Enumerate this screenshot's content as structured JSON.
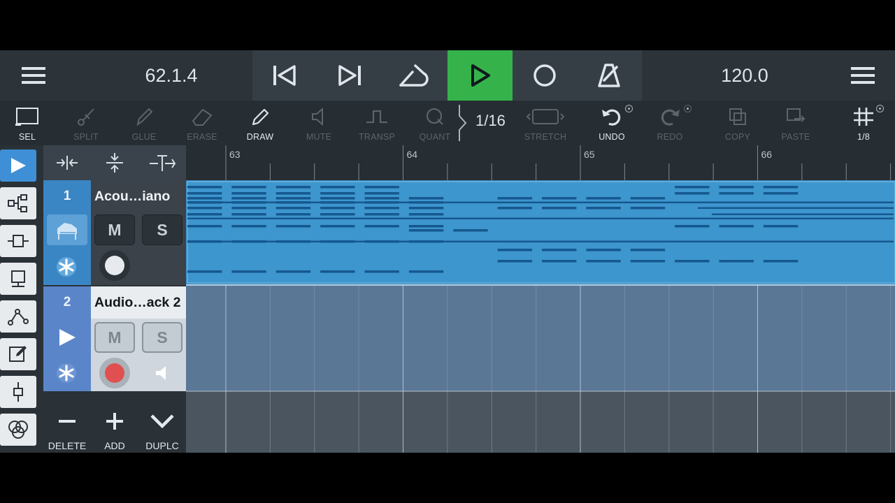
{
  "transport": {
    "position": "62.1.4",
    "tempo": "120.0",
    "buttons": [
      "main-menu",
      "rewind",
      "skip-forward",
      "loop",
      "play",
      "record",
      "metronome",
      "settings-menu"
    ]
  },
  "tools": {
    "sel": "SEL",
    "split": "SPLIT",
    "glue": "GLUE",
    "erase": "ERASE",
    "draw": "DRAW",
    "mute": "MUTE",
    "transp": "TRANSP",
    "quant": "QUANT",
    "quant_value": "1/16",
    "stretch": "STRETCH",
    "undo": "UNDO",
    "redo": "REDO",
    "copy": "COPY",
    "paste": "PASTE",
    "grid": "1/8"
  },
  "ruler": {
    "bars": [
      "63",
      "64",
      "65",
      "66"
    ]
  },
  "tracks": [
    {
      "number": "1",
      "name": "Acou…iano",
      "mute": "M",
      "solo": "S",
      "type": "instrument"
    },
    {
      "number": "2",
      "name": "Audio…ack 2",
      "mute": "M",
      "solo": "S",
      "type": "audio"
    }
  ],
  "track_controls": {
    "delete": "DELETE",
    "add": "ADD",
    "duplicate": "DUPLC"
  },
  "colors": {
    "play_active": "#35b34a",
    "accent": "#3f8fd6",
    "midi_region": "#3d96cd",
    "audio_lane": "#5a7796",
    "record_arm": "#e05050"
  }
}
